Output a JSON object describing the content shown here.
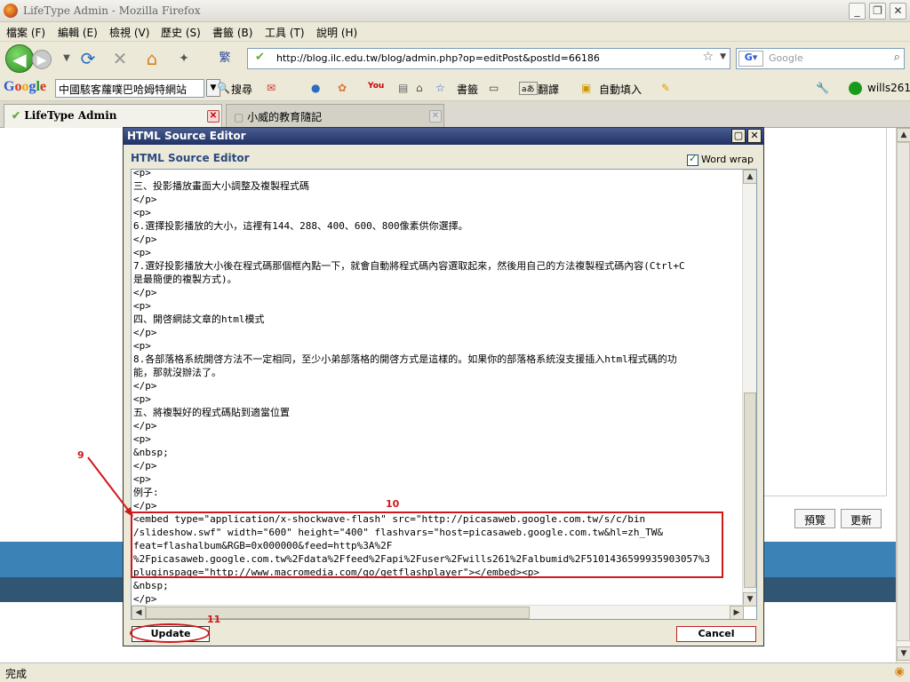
{
  "window": {
    "title": "LifeType Admin - Mozilla Firefox",
    "controls": [
      "_",
      "❐",
      "✕"
    ]
  },
  "menu": [
    "檔案 (F)",
    "編輯 (E)",
    "檢視 (V)",
    "歷史 (S)",
    "書籤 (B)",
    "工具 (T)",
    "說明 (H)"
  ],
  "nav": {
    "url": "http://blog.ilc.edu.tw/blog/admin.php?op=editPost&postId=66186",
    "search_placeholder": "Google",
    "extra_glyph": "繁"
  },
  "google_toolbar": {
    "logo": "Google",
    "site_select": "中國駭客蘿噗巴哈姆特網站",
    "search_label": "搜尋",
    "bookmarks_label": "書籤",
    "translate_label": "翻譯",
    "autofill_label": "自動填入",
    "user_label": "wills261"
  },
  "tabs": [
    {
      "label": "LifeType Admin",
      "active": true
    },
    {
      "label": "小威的教育隨記",
      "active": false
    }
  ],
  "page_buttons": {
    "preview": "預覽",
    "update": "更新"
  },
  "dialog": {
    "title": "HTML Source Editor",
    "heading": "HTML Source Editor",
    "word_wrap_label": "Word wrap",
    "word_wrap_checked": true,
    "code_lines": [
      "<p>",
      "三、投影播放畫面大小調整及複製程式碼",
      "</p>",
      "<p>",
      "6.選擇投影播放的大小，這裡有144、288、400、600、800像素供你選擇。",
      "</p>",
      "<p>",
      "7.選好投影播放大小後在程式碼那個框內點一下，就會自動將程式碼內容選取起來，然後用自己的方法複製程式碼內容(Ctrl+C",
      "是最簡便的複製方式)。",
      "</p>",
      "<p>",
      "四、開啓網誌文章的html模式",
      "</p>",
      "<p>",
      "8.各部落格系統開啓方法不一定相同，至少小弟部落格的開啓方式是這樣的。如果你的部落格系統沒支援插入html程式碼的功",
      "能，那就沒辦法了。",
      "</p>",
      "<p>",
      "五、將複製好的程式碼貼到適當位置",
      "</p>",
      "<p>",
      "&nbsp;",
      "</p>",
      "<p>",
      "例子:",
      "</p>",
      "<embed type=\"application/x-shockwave-flash\" src=\"http://picasaweb.google.com.tw/s/c/bin",
      "/slideshow.swf\" width=\"600\" height=\"400\" flashvars=\"host=picasaweb.google.com.tw&hl=zh_TW&",
      "feat=flashalbum&RGB=0x000000&feed=http%3A%2F",
      "%2Fpicasaweb.google.com.tw%2Fdata%2Ffeed%2Fapi%2Fuser%2Fwills261%2Falbumid%2F5101436599935903057%3",
      "pluginspage=\"http://www.macromedia.com/go/getflashplayer\"></embed><p>",
      "&nbsp;",
      "</p>"
    ],
    "update_label": "Update",
    "cancel_label": "Cancel"
  },
  "annotations": {
    "a9": "9",
    "a10": "10",
    "a11": "11"
  },
  "status": "完成",
  "accent": {
    "annotation": "#d0181a",
    "dialog_title": "#1f3166"
  }
}
